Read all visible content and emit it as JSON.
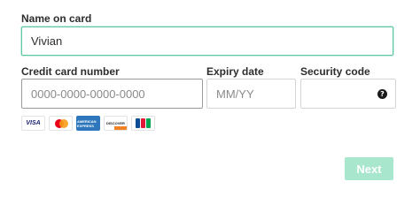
{
  "name_on_card": {
    "label": "Name on card",
    "value": "Vivian"
  },
  "card_number": {
    "label": "Credit card number",
    "placeholder": "0000-0000-0000-0000"
  },
  "expiry": {
    "label": "Expiry date",
    "placeholder": "MM/YY"
  },
  "security_code": {
    "label": "Security code",
    "help_icon": "?"
  },
  "card_logos": {
    "visa": "VISA",
    "amex": "AMERICAN EXPRESS",
    "discover": "DISCOVER"
  },
  "next_button": {
    "label": "Next"
  },
  "colors": {
    "focus_border": "#5ec8a1",
    "next_disabled_bg": "#a9e6ce"
  }
}
